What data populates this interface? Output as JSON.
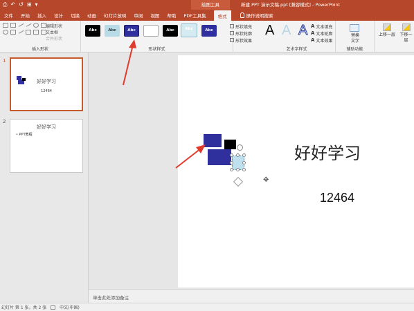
{
  "titlebar": {
    "qat": [
      "⎙",
      "↶",
      "↺",
      "⊞",
      "▾"
    ],
    "context_group": "绘图工具",
    "doc_title": "新建 PPT 演示文稿.ppt [兼容模式] - PowerPoint"
  },
  "tabs": [
    "文件",
    "开始",
    "插入",
    "设计",
    "切换",
    "动画",
    "幻灯片放映",
    "审阅",
    "视图",
    "帮助",
    "PDF工具集",
    "格式"
  ],
  "active_tab": "格式",
  "tell_me": "操作说明搜索",
  "ribbon": {
    "insert_shapes": {
      "label": "插入形状",
      "edit_shape": "编辑形状",
      "text_box": "文本框",
      "merge_shapes": "合并形状"
    },
    "shape_styles": {
      "label": "形状样式",
      "swatches": [
        {
          "text": "Abc",
          "bg": "#000000",
          "fg": "#ffffff",
          "border": "#000000"
        },
        {
          "text": "Abc",
          "bg": "#b9dbe5",
          "fg": "#333333",
          "border": "#b9dbe5"
        },
        {
          "text": "Abc",
          "bg": "#2f2f9e",
          "fg": "#ffffff",
          "border": "#1a1a6e"
        },
        {
          "text": "",
          "bg": "#ffffff",
          "fg": "#333333",
          "border": "#aaaaaa"
        },
        {
          "text": "Abc",
          "bg": "#000000",
          "fg": "#ffffff",
          "border": "#000000"
        },
        {
          "text": "Abc",
          "bg": "#d5ebf2",
          "fg": "#ffffff",
          "border": "#8fb7c9"
        },
        {
          "text": "Abc",
          "bg": "#2f2f9e",
          "fg": "#ffffff",
          "border": "#2f2f9e"
        }
      ],
      "fill": "形状填充",
      "outline": "形状轮廓",
      "effects": "形状效果"
    },
    "wordart": {
      "label": "艺术字样式",
      "samples": [
        "A",
        "A",
        "A"
      ],
      "text_fill": "文本填充",
      "text_outline": "文本轮廓",
      "text_effects": "文本效果"
    },
    "accessibility": {
      "label": "辅助功能",
      "alt_text_line1": "替换",
      "alt_text_line2": "文字"
    },
    "arrange": {
      "bring_forward": "上移一层",
      "send_backward": "下移一层"
    }
  },
  "thumbnails": [
    {
      "number": "1",
      "title": "好好学习",
      "subtitle": "12464"
    },
    {
      "number": "2",
      "title": "好好学习",
      "subtitle": "• PPT教程"
    }
  ],
  "slide": {
    "title": "好好学习",
    "subtitle": "12464"
  },
  "notes_placeholder": "单击此处添加备注",
  "statusbar": {
    "slide_info": "幻灯片 第 1 张，共 2 张",
    "language": "中文(中国)"
  },
  "colors": {
    "accent": "#b7472a",
    "shape_blue": "#2f2f9e",
    "annotation_arrow": "#e03a2c"
  }
}
